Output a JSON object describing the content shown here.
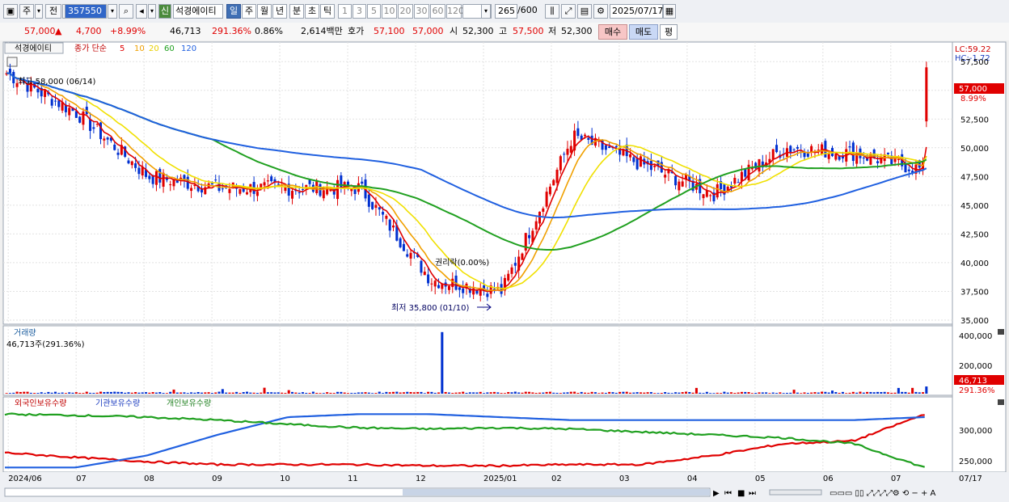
{
  "toolbar": {
    "period_prefix": "주",
    "period_selected": "전",
    "stock_code": "357550",
    "badge": "신",
    "stock_name": "석경에이티",
    "periods": [
      "일",
      "주",
      "월",
      "년",
      "분",
      "초",
      "틱"
    ],
    "intervals": [
      "1",
      "3",
      "5",
      "10",
      "20",
      "30",
      "60",
      "120"
    ],
    "count": "265",
    "count_max": "/600",
    "date": "2025/07/17"
  },
  "quote": {
    "price": "57,000",
    "change_arrow": "▲",
    "change": "4,700",
    "change_pct": "+8.99%",
    "volume": "46,713",
    "volume_ratio": "291.36%",
    "turnover_pct": "0.86%",
    "amount": "2,614백만",
    "hoga_label": "호가",
    "ask": "57,100",
    "bid": "57,000",
    "open_label": "시",
    "open": "52,300",
    "high_label": "고",
    "high": "57,500",
    "low_label": "저",
    "low": "52,300",
    "buy": "매수",
    "sell": "매도",
    "flat": "평"
  },
  "legend": {
    "name": "석경에이티",
    "label": "종가 단순",
    "ma": [
      "5",
      "10",
      "20",
      "60",
      "120"
    ],
    "ma_colors": [
      "#e00000",
      "#f0a000",
      "#f0e000",
      "#20a020",
      "#2060e0"
    ]
  },
  "annotations": {
    "max": "최고 58,000 (06/14)",
    "min": "최저 35,800 (01/10)",
    "ex": "권리락(0.00%)",
    "lc": "LC:59.22",
    "hc": "HC:-1.72"
  },
  "price_axis": [
    "57,500",
    "55,000",
    "52,500",
    "50,000",
    "47,500",
    "45,000",
    "42,500",
    "40,000",
    "37,500",
    "35,000"
  ],
  "price_tag": "57,000",
  "price_tag_pct": "8.99%",
  "volume_panel": {
    "title": "거래량",
    "value": "46,713주(291.36%)",
    "axis": [
      "400,000",
      "200,000"
    ],
    "tag": "46,713",
    "tag_pct": "291.36%"
  },
  "holdings_panel": {
    "legend": [
      "외국인보유수량",
      "기관보유수량",
      "개인보유수량"
    ],
    "axis": [
      "300,000",
      "250,000"
    ]
  },
  "x_axis": [
    "2024/06",
    "07",
    "08",
    "09",
    "10",
    "11",
    "12",
    "2025/01",
    "02",
    "03",
    "04",
    "05",
    "06",
    "07",
    "07/17"
  ],
  "colors": {
    "up": "#e00000",
    "down": "#0030d0",
    "foreign": "#e00000",
    "inst": "#2060e0",
    "indiv": "#20a020"
  },
  "chart_data": [
    {
      "type": "candlestick",
      "name": "price",
      "x_labels": [
        "2024/06",
        "07",
        "08",
        "09",
        "10",
        "11",
        "12",
        "2025/01",
        "02",
        "03",
        "04",
        "05",
        "06",
        "07"
      ],
      "close_by_month": [
        56500,
        53000,
        47500,
        46500,
        46500,
        46500,
        38500,
        37500,
        51000,
        48500,
        46000,
        50000,
        49500,
        48000
      ],
      "max": {
        "value": 58000,
        "date": "06/14"
      },
      "min": {
        "value": 35800,
        "date": "01/10"
      },
      "last": {
        "open": 52300,
        "high": 57500,
        "low": 52300,
        "close": 57000
      },
      "ylim": [
        35000,
        58500
      ]
    },
    {
      "type": "bar",
      "name": "volume",
      "last": 46713,
      "peak": 400000,
      "ylim": [
        0,
        420000
      ]
    },
    {
      "type": "line",
      "name": "holdings",
      "series": [
        {
          "name": "외국인보유수량",
          "values": [
            270000,
            262000,
            255000,
            250000,
            250000,
            250000,
            248000,
            248000,
            250000,
            250000,
            265000,
            285000,
            290000,
            335000
          ]
        },
        {
          "name": "기관보유수량",
          "values": [
            245000,
            245000,
            265000,
            300000,
            330000,
            335000,
            335000,
            330000,
            325000,
            325000,
            325000,
            325000,
            325000,
            330000
          ]
        },
        {
          "name": "개인보유수량",
          "values": [
            335000,
            333000,
            330000,
            325000,
            318000,
            312000,
            310000,
            312000,
            310000,
            305000,
            300000,
            295000,
            285000,
            245000
          ]
        }
      ],
      "ylim": [
        240000,
        345000
      ]
    }
  ]
}
